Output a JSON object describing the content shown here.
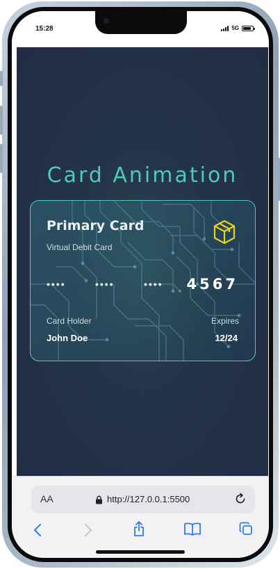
{
  "status_bar": {
    "time": "15:28",
    "network": "5G"
  },
  "page": {
    "heading": "Card Animation",
    "accent_color": "#4fc8bf",
    "background_color": "#222c45"
  },
  "card": {
    "title": "Primary Card",
    "subtitle": "Virtual Debit Card",
    "number_groups": [
      "••••",
      "••••",
      "••••"
    ],
    "last_four": "4567",
    "holder_label": "Card Holder",
    "holder_name": "John Doe",
    "expires_label": "Expires",
    "expires_value": "12/24",
    "logo_icon": "cube-icon",
    "logo_color": "#e8d21c"
  },
  "browser": {
    "text_size_label": "AA",
    "url": "http://127.0.0.1:5500",
    "toolbar_icons": [
      "back-icon",
      "forward-icon",
      "share-icon",
      "bookmarks-icon",
      "tabs-icon"
    ]
  }
}
